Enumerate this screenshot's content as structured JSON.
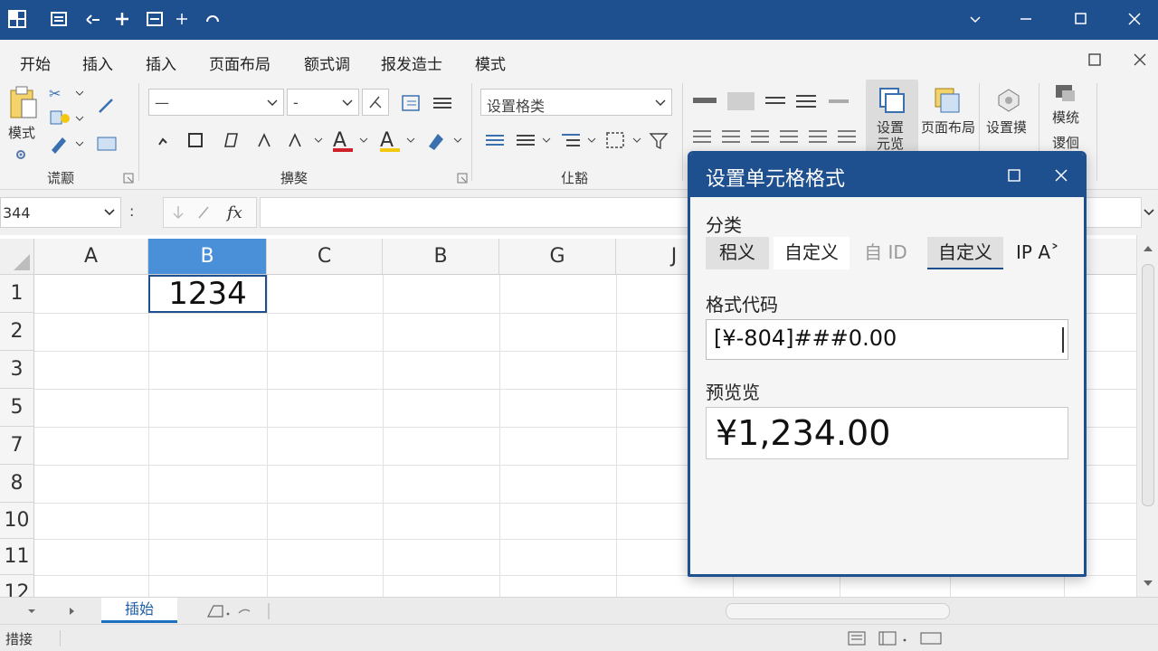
{
  "ribbon": {
    "tabs": [
      "开始",
      "插入",
      "插入",
      "页面布局",
      "额式调",
      "报发造士",
      "模式"
    ],
    "group_labels": [
      "谎颥",
      "擤獒",
      "仩豁"
    ],
    "font_name_value": "—",
    "font_size_value": "-",
    "number_format_value": "设置格类",
    "mode_label": "模式",
    "big_buttons": {
      "set_cells": "设置 元览",
      "page_layout": "页面布局",
      "set_perm": "设置摸",
      "template": "模统 谡佪"
    }
  },
  "formula_bar": {
    "name_box": "344",
    "separator": ":"
  },
  "grid": {
    "columns": [
      "A",
      "B",
      "C",
      "B",
      "G",
      "J"
    ],
    "selected_column": "B",
    "rows": [
      "1",
      "2",
      "3",
      "5",
      "7",
      "8",
      "10",
      "11",
      "12"
    ],
    "cell_b1": "1234"
  },
  "sheet_tabs": {
    "active": "插始"
  },
  "status": {
    "text": "措接"
  },
  "dialog": {
    "title": "设置单元格格式",
    "category_label": "分类",
    "categories": [
      "稆义",
      "自定义",
      "自 ID",
      "自定义",
      "IP A˃"
    ],
    "format_code_label": "格式代码",
    "format_code": "[¥-804]###0.00",
    "preview_label": "预览览",
    "preview_value": "¥1,234.00"
  },
  "colors": {
    "title_bar": "#1e4f8f",
    "selected_header": "#4a90d9",
    "font_red": "#d0202a",
    "font_yellow": "#f2c811"
  }
}
